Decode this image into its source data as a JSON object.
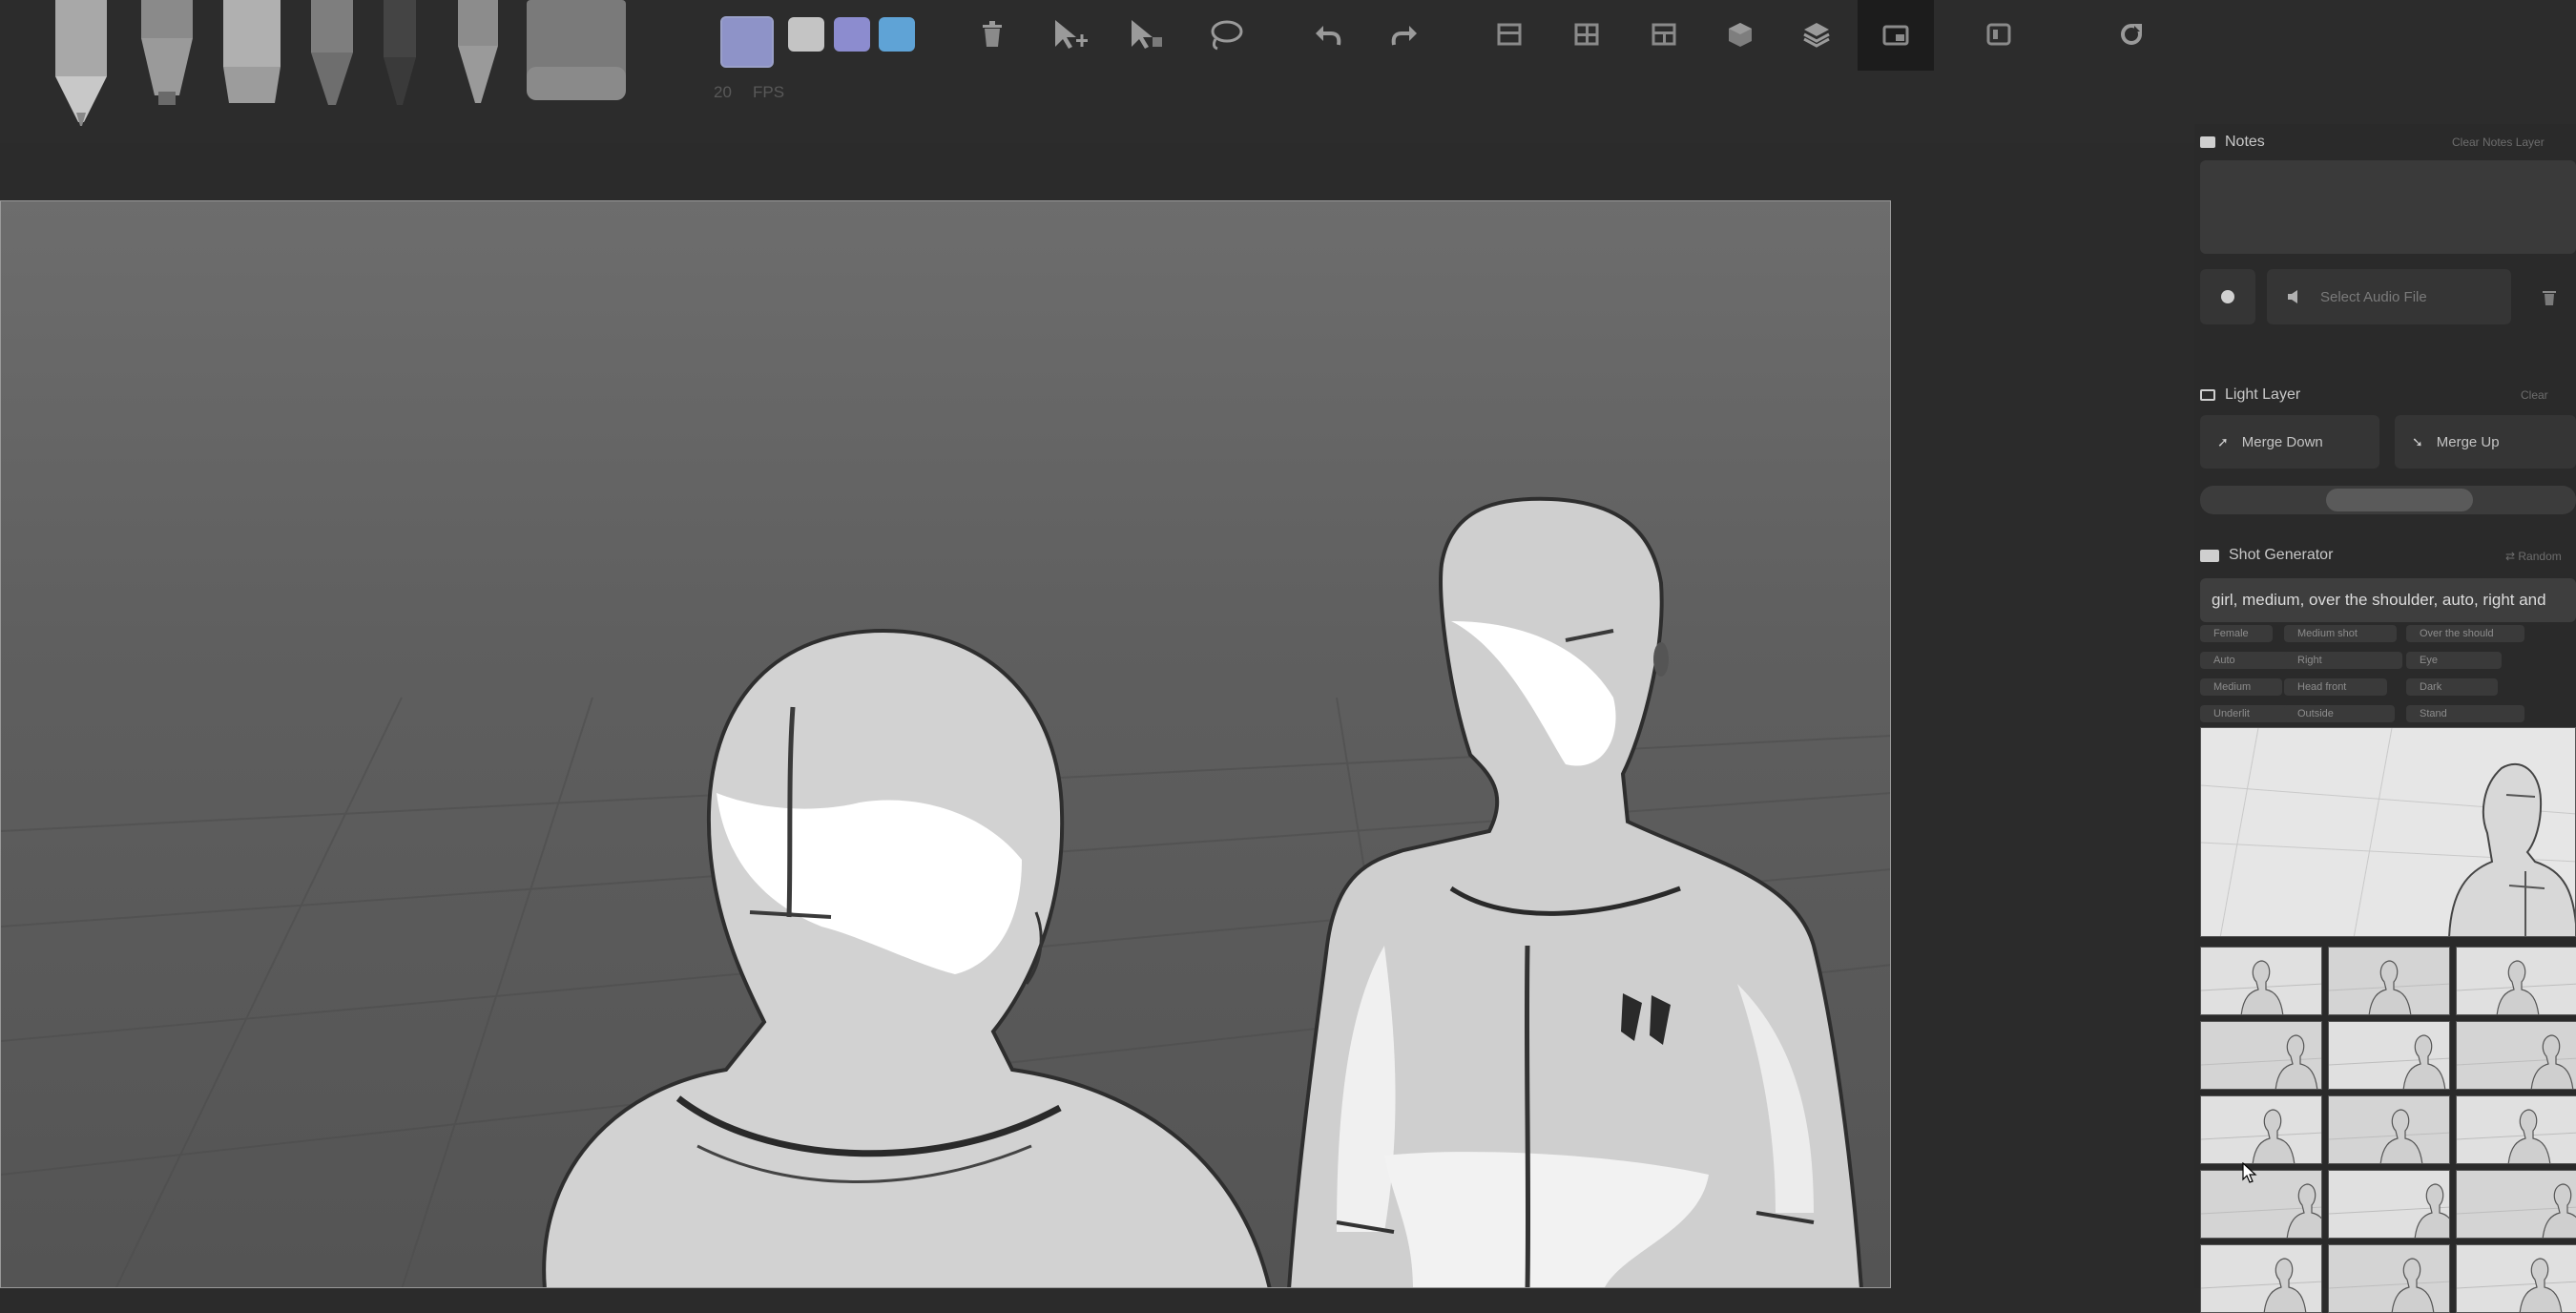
{
  "toolbar": {
    "pencils": [
      "pencil-tool",
      "marker-tool",
      "chisel-tool",
      "fine-pen-tool",
      "ink-pen-tool",
      "brush-pen-tool",
      "eraser-tool"
    ],
    "swatches": [
      "#8e93c8",
      "#c4c4c4",
      "#8c8ccf",
      "#5fa3d6"
    ],
    "swatch_labels": [
      "20",
      "FPS"
    ],
    "icons": [
      "trash-icon",
      "add-select-icon",
      "move-select-icon",
      "lasso-icon",
      "undo-icon",
      "redo-icon",
      "layout-single-icon",
      "layout-grid-icon",
      "layout-split-icon",
      "3d-cube-icon",
      "layers-icon",
      "camera-view-icon",
      "photoshop-icon",
      "refresh-icon"
    ]
  },
  "panel": {
    "notes": {
      "title": "Notes",
      "clear_label": "Clear Notes Layer"
    },
    "audio": {
      "placeholder": "Select Audio File"
    },
    "light_layer": {
      "title": "Light Layer",
      "clear_label": "Clear",
      "merge_down": "Merge Down",
      "merge_up": "Merge Up",
      "opacity": 0.55
    },
    "shot_generator": {
      "title": "Shot Generator",
      "random_label": "Random",
      "prompt": "girl, medium, over the shoulder, auto, right and",
      "chips": [
        [
          "Female",
          "Medium shot",
          "Over the should"
        ],
        [
          "Auto",
          "Right",
          "Eye"
        ],
        [
          "Medium",
          "Head front",
          "Dark"
        ],
        [
          "Underlit",
          "Outside",
          "Stand"
        ]
      ]
    }
  },
  "colors": {
    "bg": "#2b2b2b",
    "canvas": "#646464",
    "accent": "#8e93c8"
  }
}
